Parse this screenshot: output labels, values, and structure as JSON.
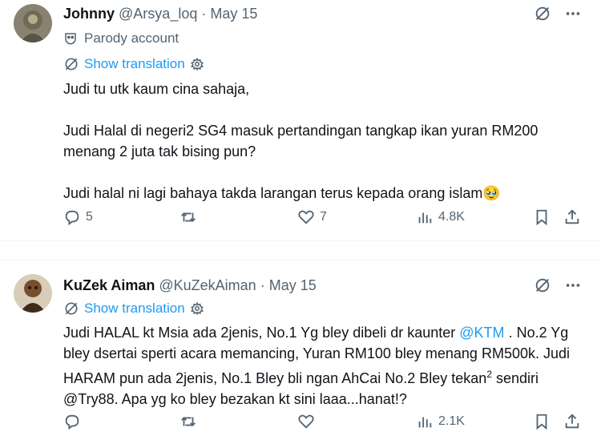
{
  "posts": [
    {
      "author_name": "Johnny",
      "handle": "@Arsya_loq",
      "separator": "·",
      "date": "May 15",
      "badge_label": "Parody account",
      "show_translation": "Show translation",
      "body": [
        "Judi tu utk kaum cina sahaja,",
        "Judi Halal di negeri2 SG4 masuk pertandingan tangkap ikan yuran RM200 menang 2 juta tak bising pun?",
        "Judi halal ni lagi bahaya takda larangan terus kepada orang islam🥹"
      ],
      "stats": {
        "replies": "5",
        "reposts": "",
        "likes": "7",
        "views": "4.8K"
      }
    },
    {
      "author_name": "KuZek Aiman",
      "handle": "@KuZekAiman",
      "separator": "·",
      "date": "May 15",
      "show_translation": "Show translation",
      "body_parts": {
        "p1": "Judi HALAL kt Msia ada 2jenis, No.1 Yg bley dibeli dr kaunter ",
        "mention": "@KTM",
        "p2": " . No.2 Yg bley dsertai sperti acara memancing, Yuran RM100 bley menang RM500k. Judi HARAM pun ada 2jenis, No.1 Bley bli ngan AhCai No.2 Bley tekan",
        "sup": "2",
        "p3": " sendiri @Try88. Apa yg ko bley bezakan kt sini laaa...hanat!?"
      },
      "stats": {
        "replies": "",
        "reposts": "",
        "likes": "",
        "views": "2.1K"
      }
    }
  ],
  "icons": {
    "grok": "grok-icon",
    "more": "more-icon",
    "parody": "mask-icon",
    "translate": "translate-icon",
    "settings": "gear-icon",
    "reply": "reply-icon",
    "repost": "repost-icon",
    "like": "heart-icon",
    "views": "views-icon",
    "bookmark": "bookmark-icon",
    "share": "share-icon"
  },
  "colors": {
    "accent": "#1d9bf0",
    "muted": "#536471",
    "text": "#0f1419"
  }
}
